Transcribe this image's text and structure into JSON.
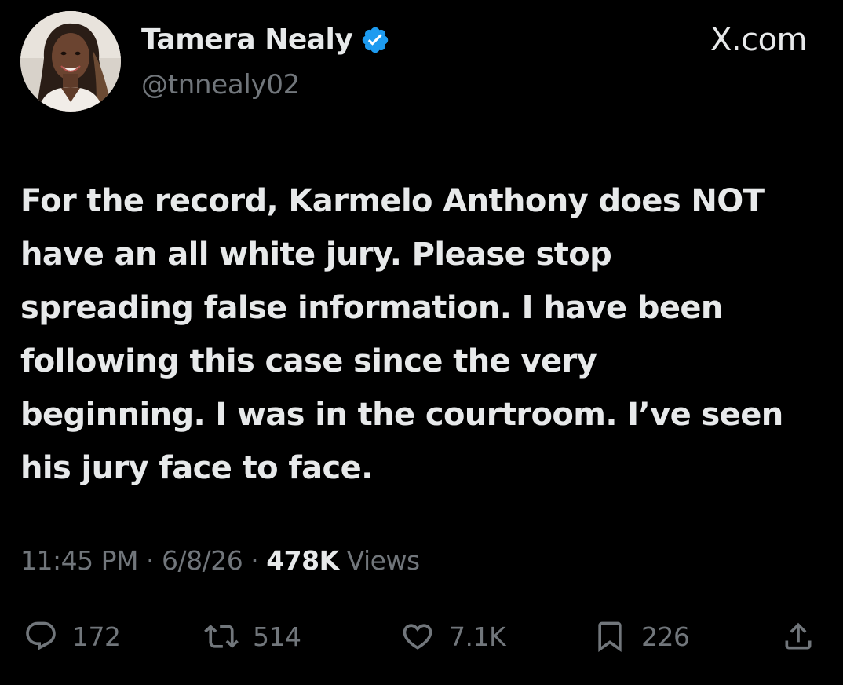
{
  "header": {
    "display_name": "Tamera Nealy",
    "handle": "@tnnealy02",
    "brand": "X.com",
    "avatar_icon": "profile-photo"
  },
  "tweet": {
    "text": "For the record, Karmelo Anthony does NOT\nhave an all white jury. Please stop\nspreading false information. I have been\nfollowing this case since the very\nbeginning. I was in the courtroom. I’ve seen\nhis jury face to face."
  },
  "meta": {
    "time": "11:45 PM",
    "separator": "·",
    "date": "6/8/26",
    "views_count": "478K",
    "views_label": "Views"
  },
  "actions": {
    "replies": "172",
    "retweets": "514",
    "likes": "7.1K",
    "bookmarks": "226"
  },
  "colors": {
    "background": "#000000",
    "text": "#e7e9ea",
    "muted": "#71767b",
    "verified": "#1d9bf0"
  }
}
